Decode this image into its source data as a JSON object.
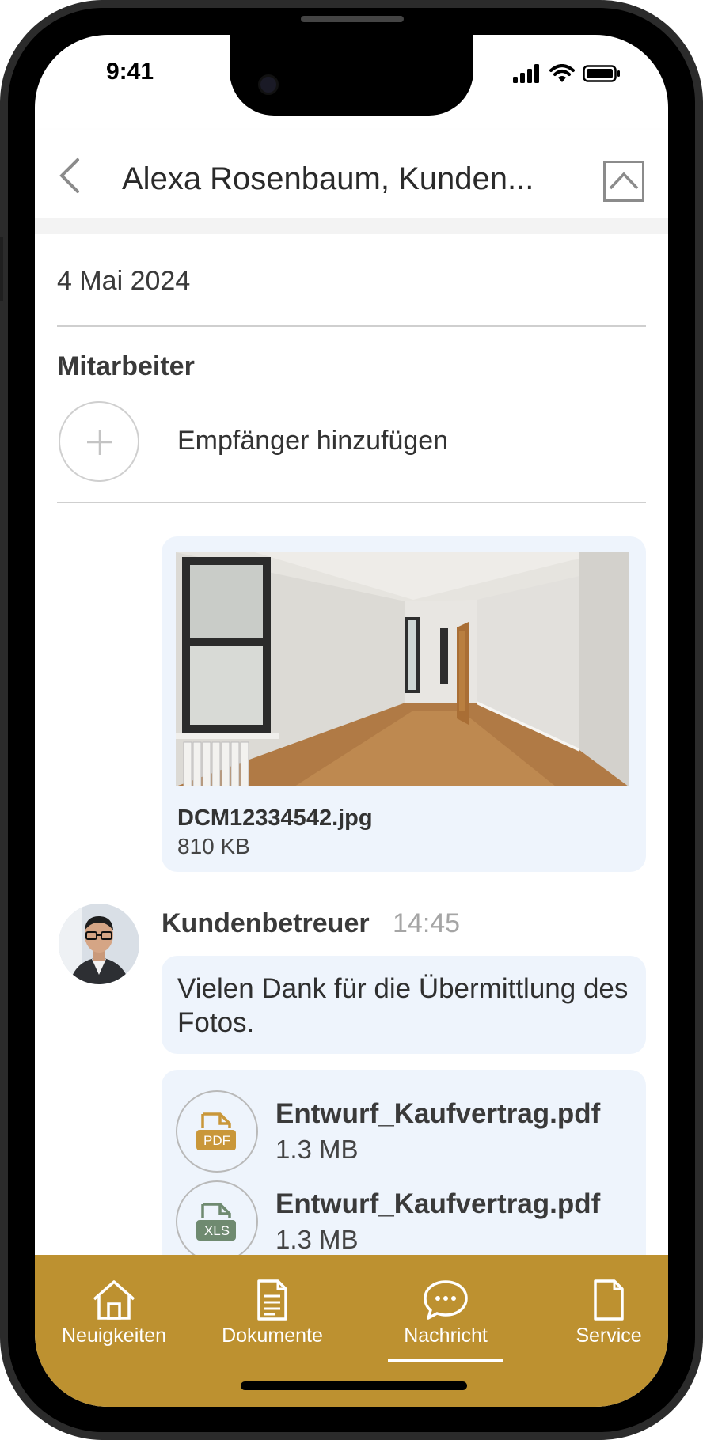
{
  "status_bar": {
    "time": "9:41"
  },
  "header": {
    "title": "Alexa Rosenbaum, Kunden..."
  },
  "conversation": {
    "date": "4 Mai 2024",
    "section_title": "Mitarbeiter",
    "add_recipient_label": "Empfänger hinzufügen"
  },
  "photo_message": {
    "file_name": "DCM12334542.jpg",
    "file_size": "810 KB"
  },
  "reply": {
    "sender": "Kundenbetreuer",
    "time": "14:45",
    "text": "Vielen Dank für die Übermittlung des Fotos.",
    "attachments": [
      {
        "name": "Entwurf_Kaufvertrag.pdf",
        "size": "1.3 MB",
        "type_label": "PDF",
        "color": "#c9973a"
      },
      {
        "name": "Entwurf_Kaufvertrag.pdf",
        "size": "1.3 MB",
        "type_label": "XLS",
        "color": "#6f8a70"
      }
    ]
  },
  "tab_bar": {
    "accent_color": "#bd9130",
    "active_tab": "Nachricht",
    "tabs": [
      {
        "label": "Neuigkeiten",
        "icon": "home-icon"
      },
      {
        "label": "Dokumente",
        "icon": "document-icon"
      },
      {
        "label": "Nachricht",
        "icon": "chat-icon"
      },
      {
        "label": "Service",
        "icon": "file-icon"
      }
    ]
  }
}
